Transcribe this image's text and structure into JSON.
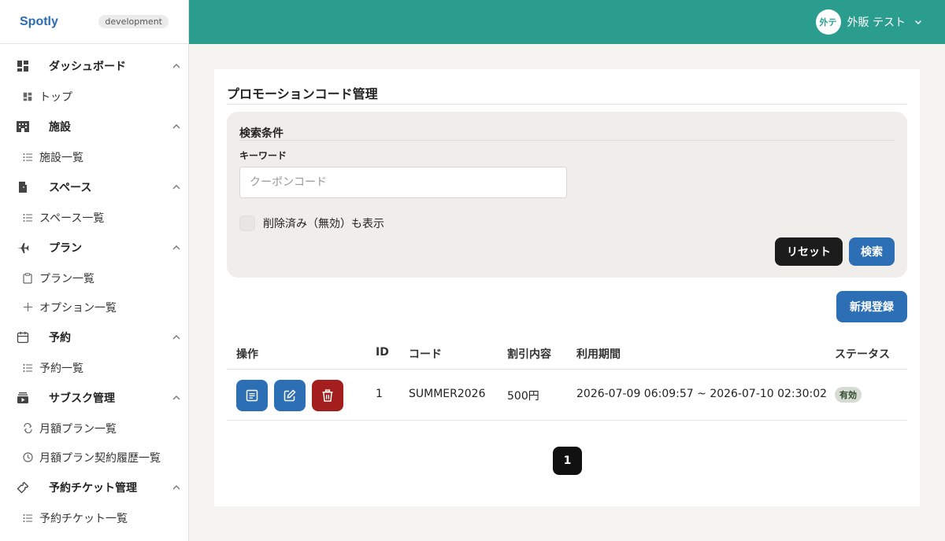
{
  "brand": {
    "name": "Spotly",
    "env": "development"
  },
  "header": {
    "avatar_initials": "外テ",
    "user_name": "外販 テスト"
  },
  "sidebar": {
    "sections": [
      {
        "label": "ダッシュボード",
        "icon": "dashboard-icon",
        "items": [
          {
            "label": "トップ",
            "icon": "dashboard-small-icon"
          }
        ]
      },
      {
        "label": "施設",
        "icon": "building-icon",
        "items": [
          {
            "label": "施設一覧",
            "icon": "list-icon"
          }
        ]
      },
      {
        "label": "スペース",
        "icon": "door-icon",
        "items": [
          {
            "label": "スペース一覧",
            "icon": "list-icon"
          }
        ]
      },
      {
        "label": "プラン",
        "icon": "airplane-icon",
        "items": [
          {
            "label": "プラン一覧",
            "icon": "clipboard-icon"
          },
          {
            "label": "オプション一覧",
            "icon": "plus-icon"
          }
        ]
      },
      {
        "label": "予約",
        "icon": "calendar-icon",
        "items": [
          {
            "label": "予約一覧",
            "icon": "list-icon"
          }
        ]
      },
      {
        "label": "サブスク管理",
        "icon": "subscription-icon",
        "items": [
          {
            "label": "月額プラン一覧",
            "icon": "repeat-icon"
          },
          {
            "label": "月額プラン契約履歴一覧",
            "icon": "clock-icon"
          }
        ]
      },
      {
        "label": "予約チケット管理",
        "icon": "ticket-icon",
        "items": [
          {
            "label": "予約チケット一覧",
            "icon": "list-icon"
          }
        ]
      }
    ]
  },
  "main": {
    "title": "プロモーションコード管理",
    "search": {
      "title": "検索条件",
      "keyword_label": "キーワード",
      "keyword_placeholder": "クーポンコード",
      "keyword_value": "",
      "show_deleted_label": "削除済み（無効）も表示",
      "reset_label": "リセット",
      "search_label": "検索"
    },
    "new_label": "新規登録",
    "table": {
      "headers": {
        "actions": "操作",
        "id": "ID",
        "code": "コード",
        "discount": "割引内容",
        "period": "利用期間",
        "status": "ステータス"
      },
      "rows": [
        {
          "id": "1",
          "code": "SUMMER2026",
          "discount": "500円",
          "period": "2026-07-09 06:09:57 ~ 2026-07-10 02:30:02",
          "status": "有効"
        }
      ]
    },
    "pagination": {
      "current": "1"
    }
  },
  "colors": {
    "header": "#2b9d8f",
    "primary": "#2d6fb5",
    "danger": "#a41e1e",
    "brand": "#2a6db0"
  }
}
